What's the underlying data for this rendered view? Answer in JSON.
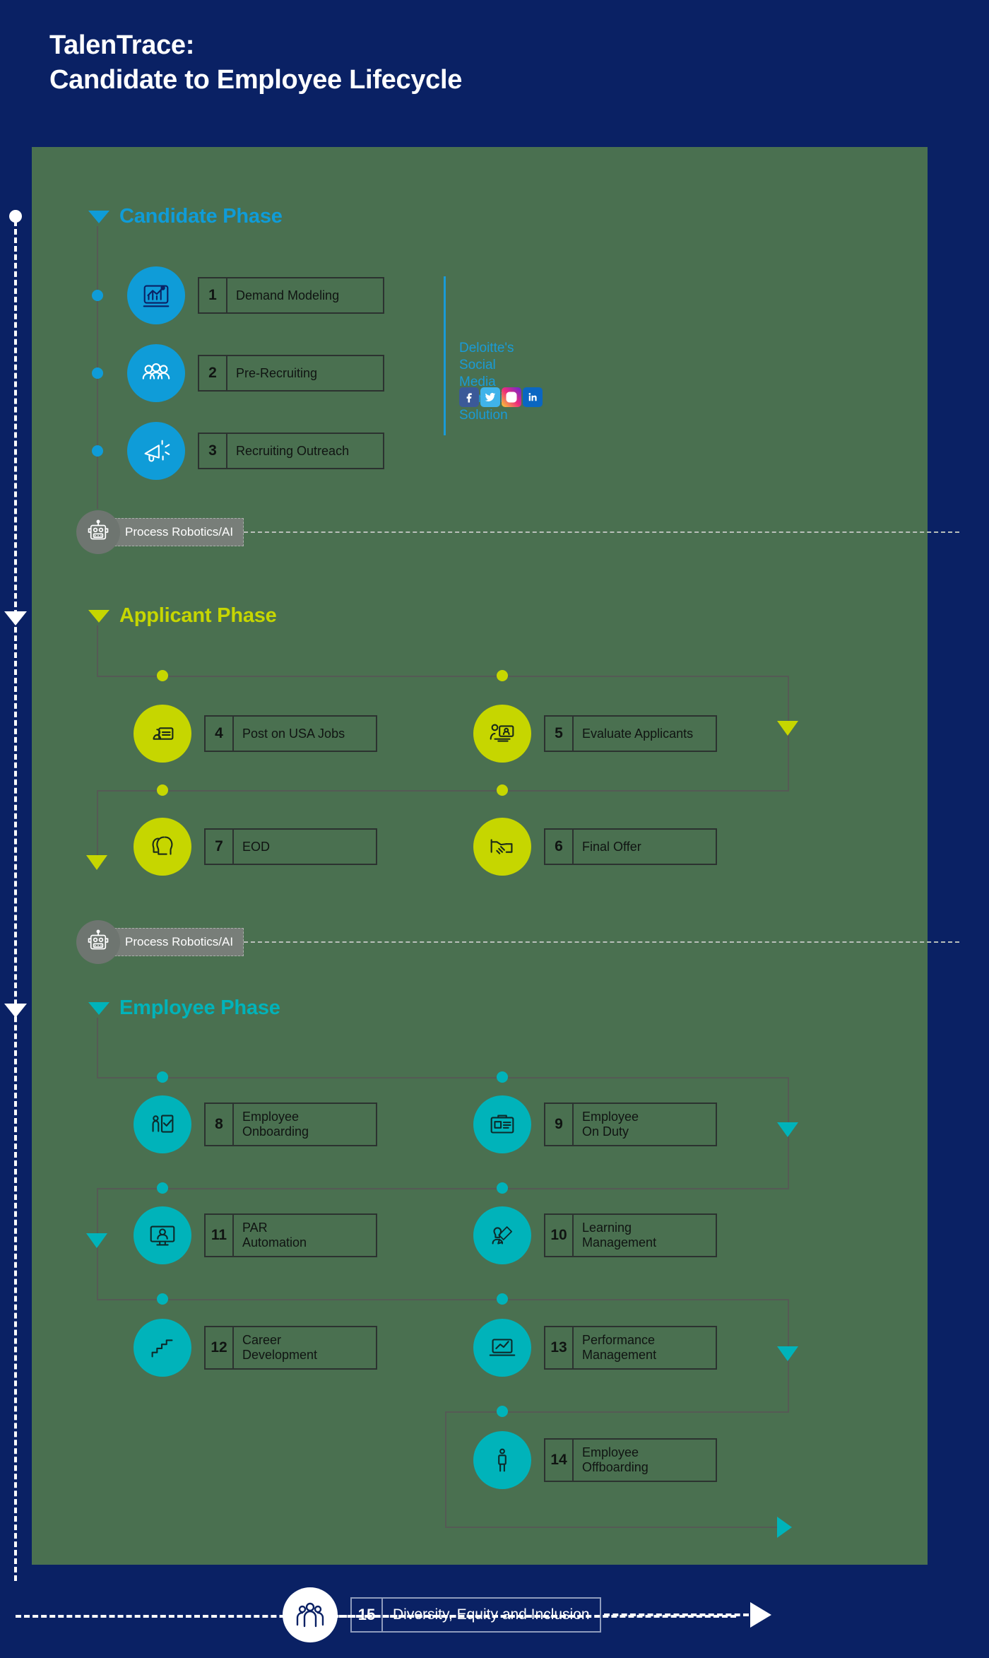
{
  "header": {
    "title_line1": "TalenTrace:",
    "title_line2": "Candidate to Employee Lifecycle"
  },
  "colors": {
    "background_blue": "#0a2164",
    "panel_green": "#4a7050",
    "candidate_blue": "#0f9cd8",
    "applicant_lime": "#c6d600",
    "employee_teal": "#00b3ba",
    "connector_gray": "#555a55",
    "robotics_gray": "#787e79",
    "white": "#ffffff"
  },
  "phases": [
    {
      "id": "candidate",
      "label": "Candidate Phase",
      "accent": "#0f9cd8",
      "steps": [
        {
          "number": "1",
          "label": "Demand Modeling",
          "icon": "chart-dashboard-icon"
        },
        {
          "number": "2",
          "label": "Pre-Recruiting",
          "icon": "people-group-icon"
        },
        {
          "number": "3",
          "label": "Recruiting Outreach",
          "icon": "megaphone-icon"
        }
      ]
    },
    {
      "id": "applicant",
      "label": "Applicant Phase",
      "accent": "#c6d600",
      "steps": [
        {
          "number": "4",
          "label": "Post on USA Jobs",
          "icon": "job-posting-icon"
        },
        {
          "number": "5",
          "label": "Evaluate Applicants",
          "icon": "interview-screen-icon"
        },
        {
          "number": "6",
          "label": "Final Offer",
          "icon": "handshake-icon"
        },
        {
          "number": "7",
          "label": "EOD",
          "icon": "two-heads-icon"
        }
      ]
    },
    {
      "id": "employee",
      "label": "Employee Phase",
      "accent": "#00b3ba",
      "steps": [
        {
          "number": "8",
          "label": "Employee\nOnboarding",
          "icon": "onboarding-door-icon"
        },
        {
          "number": "9",
          "label": "Employee\nOn Duty",
          "icon": "id-badge-icon"
        },
        {
          "number": "10",
          "label": "Learning\nManagement",
          "icon": "learning-pencil-icon"
        },
        {
          "number": "11",
          "label": "PAR\nAutomation",
          "icon": "monitor-person-icon"
        },
        {
          "number": "12",
          "label": "Career\nDevelopment",
          "icon": "stairs-icon"
        },
        {
          "number": "13",
          "label": "Performance\nManagement",
          "icon": "laptop-graph-icon"
        },
        {
          "number": "14",
          "label": "Employee\nOffboarding",
          "icon": "person-exit-icon"
        }
      ]
    }
  ],
  "robotics": [
    {
      "label": "Process Robotics/AI",
      "icon": "robot-icon"
    },
    {
      "label": "Process Robotics/AI",
      "icon": "robot-icon"
    }
  ],
  "social": {
    "text": "Deloitte's Social Media\nMarketing Solution",
    "icons": [
      {
        "name": "facebook-icon",
        "color": "#3b5998"
      },
      {
        "name": "twitter-icon",
        "color": "#40b3ea"
      },
      {
        "name": "instagram-icon",
        "color": "#d6306f"
      },
      {
        "name": "linkedin-icon",
        "color": "#0a66c2"
      }
    ]
  },
  "footer": {
    "number": "15",
    "label": "Diversity, Equity and Inclusion",
    "icon": "diversity-people-icon"
  }
}
